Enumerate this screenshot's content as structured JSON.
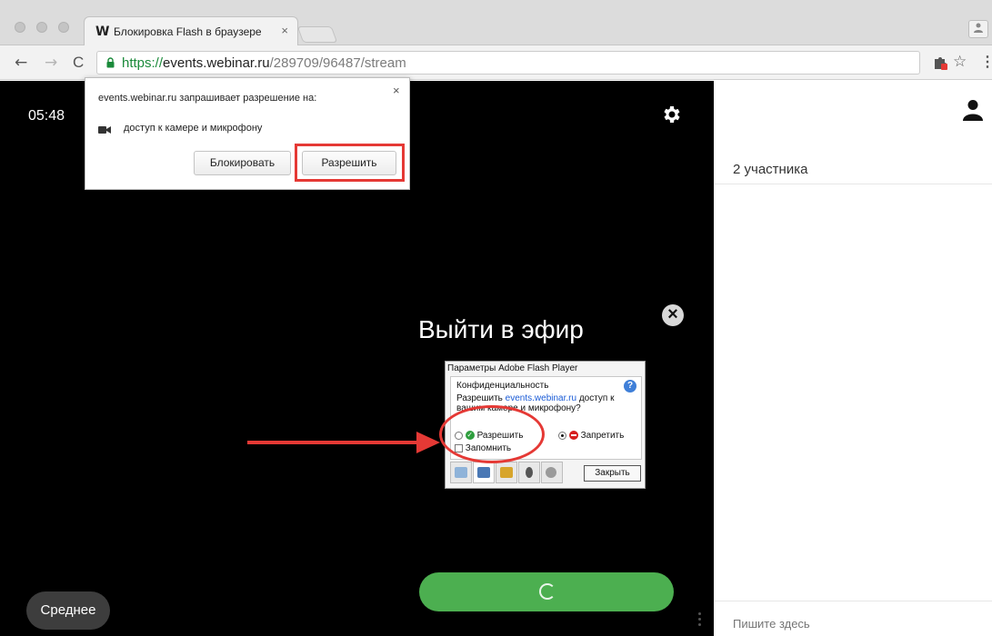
{
  "browser": {
    "tab": {
      "favicon": "W",
      "title": "Блокировка Flash в браузере",
      "close": "×"
    },
    "url": {
      "scheme": "https://",
      "host": "events.webinar.ru",
      "path": "/289709/96487/stream"
    },
    "nav": {
      "back": "←",
      "forward": "→",
      "reload": "C"
    },
    "icons": [
      "lock-icon",
      "extension-icon",
      "star-icon",
      "menu-icon",
      "profile-icon"
    ],
    "star": "☆",
    "menu": "⋮",
    "profile": "👤"
  },
  "permission_popup": {
    "title": "events.webinar.ru запрашивает разрешение на:",
    "item": "доступ к камере и микрофону",
    "close": "×",
    "block_label": "Блокировать",
    "allow_label": "Разрешить"
  },
  "stage": {
    "timer": "05:48",
    "go_live": "Выйти в эфир",
    "close": "×",
    "quality": "Среднее",
    "accent": "#4caf50"
  },
  "flash": {
    "title": "Параметры Adobe Flash Player",
    "section": "Конфиденциальность",
    "help": "?",
    "question_before": "Разрешить ",
    "question_link": "events.webinar.ru",
    "question_after": " доступ к вашим камере и микрофону?",
    "allow": "Разрешить",
    "deny": "Запретить",
    "deny_selected": true,
    "remember": "Запомнить",
    "close": "Закрыть"
  },
  "sidebar": {
    "participants": "2 участника",
    "chat_placeholder": "Пишите здесь"
  },
  "annotations": {
    "color": "#e53935"
  }
}
